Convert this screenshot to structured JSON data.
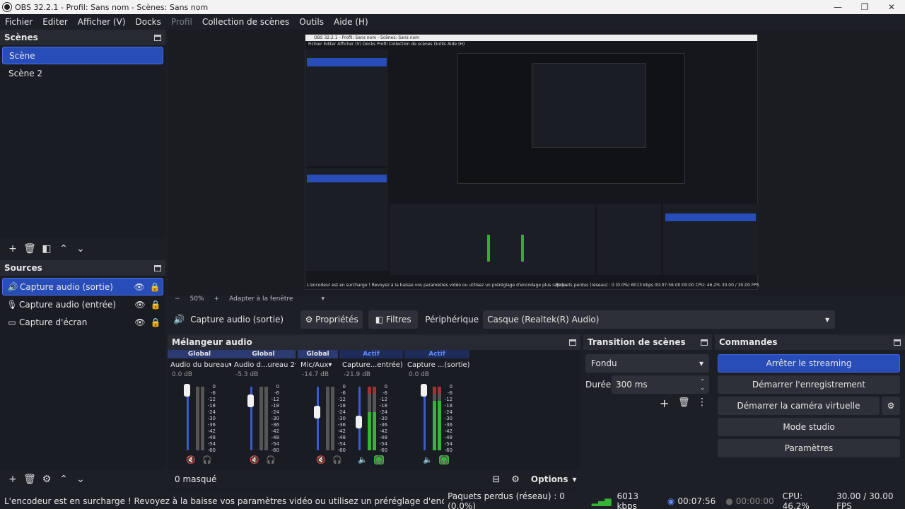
{
  "window": {
    "title": "OBS 32.2.1 - Profil: Sans nom - Scènes: Sans nom"
  },
  "menu": [
    "Fichier",
    "Editer",
    "Afficher (V)",
    "Docks",
    "Profil",
    "Collection de scènes",
    "Outils",
    "Aide (H)"
  ],
  "scenes": {
    "title": "Scènes",
    "items": [
      "Scène",
      "Scène 2"
    ]
  },
  "sources": {
    "title": "Sources",
    "items": [
      {
        "label": "Capture audio (sortie)",
        "icon": "speaker-icon"
      },
      {
        "label": "Capture audio (entrée)",
        "icon": "microphone-icon"
      },
      {
        "label": "Capture d'écran",
        "icon": "monitor-icon"
      }
    ]
  },
  "preview": {
    "zoom": "50%",
    "fit": "Adapter à la fenêtre"
  },
  "source_controls": {
    "selected": "Capture audio (sortie)",
    "properties": "Propriétés",
    "filters": "Filtres",
    "device_label": "Périphérique",
    "device_value": "Casque (Realtek(R) Audio)"
  },
  "mixer": {
    "title": "Mélangeur audio",
    "masked": "0 masqué",
    "options": "Options",
    "channels": [
      {
        "head": "Global",
        "name": "Audio du bureau",
        "db": "0.0 dB",
        "active": false,
        "level": 0.0,
        "volume": 0.95
      },
      {
        "head": "Global",
        "name": "Audio d...ureau 2",
        "db": "-5.3 dB",
        "active": false,
        "level": 0.0,
        "volume": 0.78
      },
      {
        "head": "Global",
        "name": "Mic/Aux",
        "db": "-14.7 dB",
        "active": false,
        "level": 0.0,
        "volume": 0.6
      },
      {
        "head": "Actif",
        "name": "Capture...entrée)",
        "db": "-21.9 dB",
        "active": true,
        "level": 0.6,
        "volume": 0.45
      },
      {
        "head": "Actif",
        "name": "Capture ...(sortie)",
        "db": "0.0 dB",
        "active": true,
        "level": 0.78,
        "volume": 0.95
      }
    ],
    "scale": [
      "0",
      "-6",
      "-12",
      "-18",
      "-24",
      "-30",
      "-36",
      "-42",
      "-48",
      "-54",
      "-60"
    ]
  },
  "transition": {
    "title": "Transition de scènes",
    "value": "Fondu",
    "duration_label": "Durée",
    "duration_value": "300 ms"
  },
  "commands": {
    "title": "Commandes",
    "stream": "Arrêter le streaming",
    "record": "Démarrer l'enregistrement",
    "virtualcam": "Démarrer la caméra virtuelle",
    "studio": "Mode studio",
    "settings": "Paramètres"
  },
  "status": {
    "warning": "L'encodeur est en surcharge ! Revoyez à la baisse vos paramètres vidéo ou utilisez un préréglage d'encodage plus rapide.",
    "dropped": "Paquets perdus (réseau) : 0 (0.0%)",
    "bitrate": "6013 kbps",
    "stream_time": "00:07:56",
    "rec_time": "00:00:00",
    "cpu": "CPU: 46.2%",
    "fps": "30.00 / 30.00 FPS"
  },
  "nested": {
    "title": "OBS 32.2.1 - Profil: Sans nom - Scènes: Sans nom",
    "menu": "Fichier   Editer   Afficher (V)   Docks   Profil   Collection de scènes   Outils   Aide (H)",
    "warning": "L'encodeur est en surcharge ! Revoyez à la baisse vos paramètres vidéo ou utilisez un préréglage d'encodage plus rapide.",
    "status": "Paquets perdus (réseau) : 0 (0.0%)    6013 kbps    00:07:56    00:00:00    CPU: 46.2%    30.00 / 30.00 FPS"
  }
}
